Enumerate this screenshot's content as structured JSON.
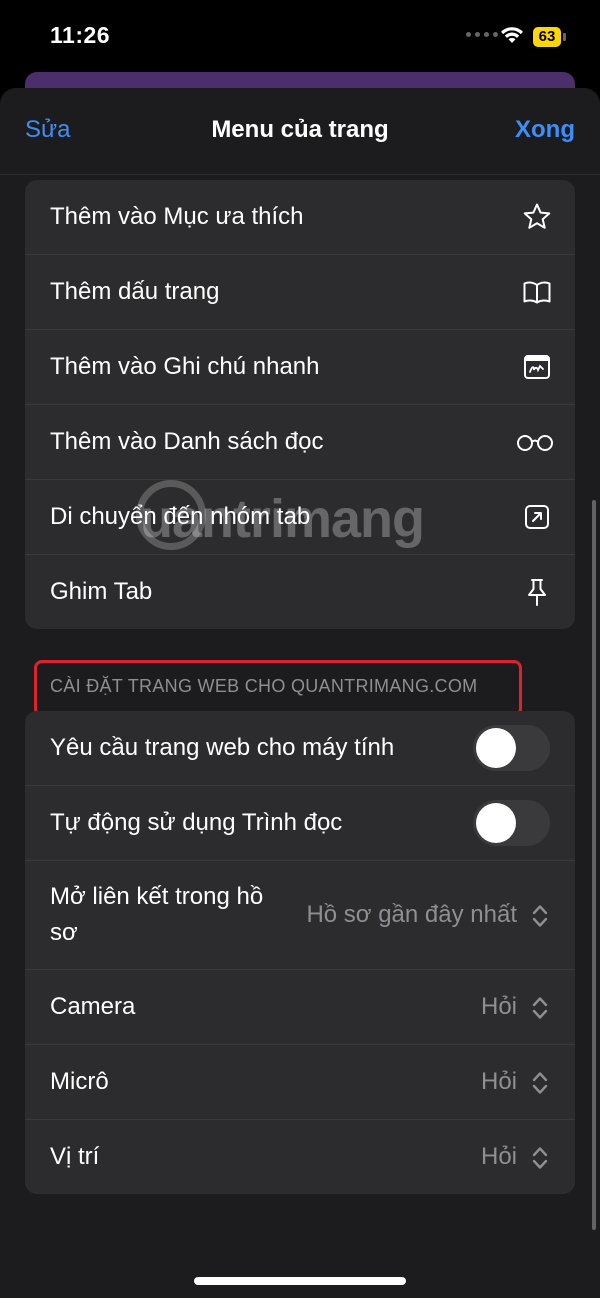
{
  "status": {
    "time": "11:26",
    "battery": "63"
  },
  "nav": {
    "edit": "Sửa",
    "title": "Menu của trang",
    "done": "Xong"
  },
  "actions": [
    {
      "label": "Thêm vào Mục ưa thích",
      "icon": "star-icon"
    },
    {
      "label": "Thêm dấu trang",
      "icon": "book-icon"
    },
    {
      "label": "Thêm vào Ghi chú nhanh",
      "icon": "quick-note-icon"
    },
    {
      "label": "Thêm vào Danh sách đọc",
      "icon": "glasses-icon"
    },
    {
      "label": "Di chuyển đến nhóm tab",
      "icon": "move-arrow-icon"
    },
    {
      "label": "Ghim Tab",
      "icon": "pin-icon"
    }
  ],
  "section_header": "CÀI ĐẶT TRANG WEB CHO QUANTRIMANG.COM",
  "settings": {
    "desktop_site": {
      "label": "Yêu cầu trang web cho máy tính",
      "on": false
    },
    "auto_reader": {
      "label": "Tự động sử dụng Trình đọc",
      "on": false
    },
    "open_links": {
      "label": "Mở liên kết trong hồ sơ",
      "value": "Hồ sơ gần đây nhất"
    },
    "camera": {
      "label": "Camera",
      "value": "Hỏi"
    },
    "microphone": {
      "label": "Micrô",
      "value": "Hỏi"
    },
    "location": {
      "label": "Vị trí",
      "value": "Hỏi"
    }
  },
  "watermark": "uantrimang",
  "colors": {
    "accent": "#3d8ef7",
    "highlight": "#e0202a",
    "battery": "#ffd60a"
  }
}
